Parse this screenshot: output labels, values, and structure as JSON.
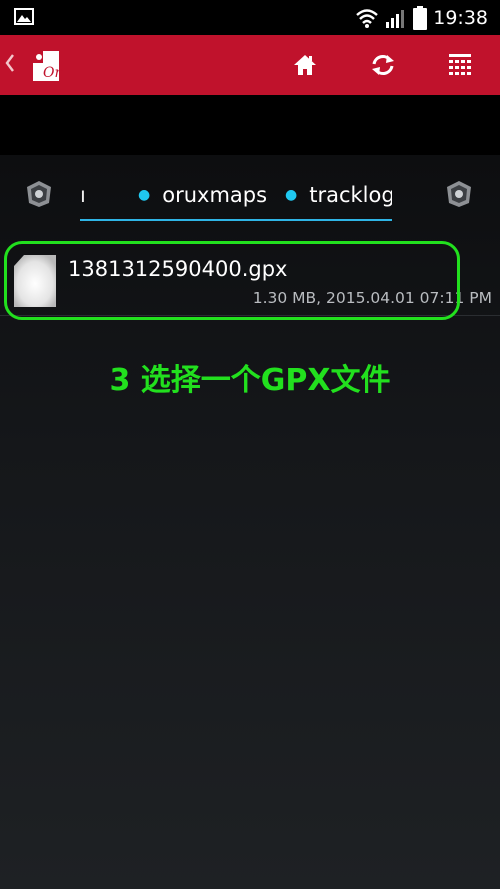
{
  "status_bar": {
    "time": "19:38",
    "icons": [
      "image-notification-icon",
      "wifi-icon",
      "signal-icon",
      "battery-icon"
    ]
  },
  "app_bar": {
    "logo_text": "Ori",
    "color": "#c0122c",
    "actions": [
      "home-icon",
      "refresh-icon",
      "grid-menu-icon"
    ]
  },
  "breadcrumb": {
    "partial": "ı",
    "items": [
      "oruxmaps",
      "tracklogs"
    ],
    "accent": "#1fc8f0"
  },
  "files": [
    {
      "name": "1381312590400.gpx",
      "meta": "1.30 MB, 2015.04.01 07:11 PM"
    }
  ],
  "annotation": {
    "text": "3 选择一个GPX文件",
    "color": "#22e01e"
  }
}
